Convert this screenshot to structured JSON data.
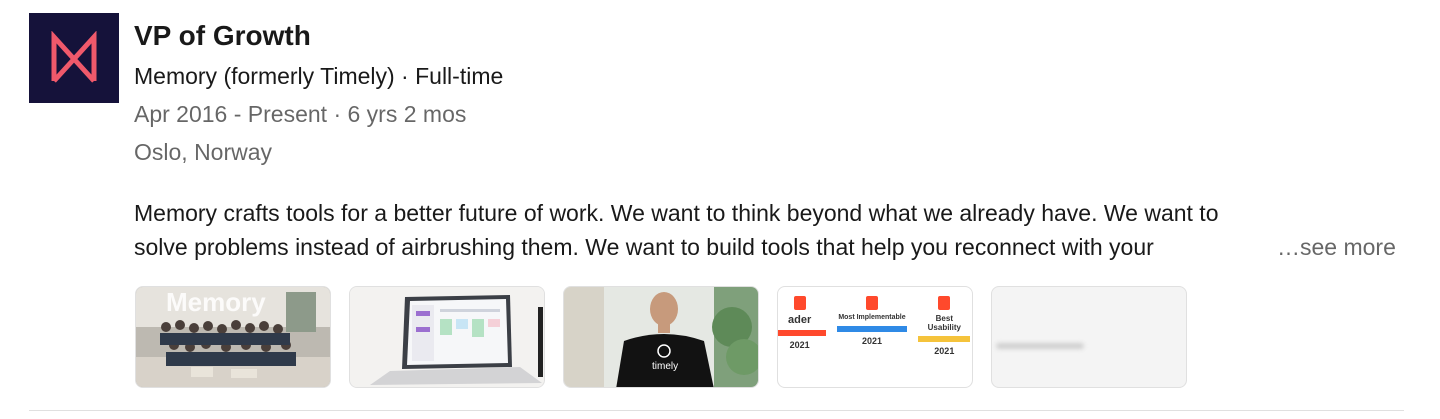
{
  "experience": {
    "title": "VP of Growth",
    "company_line": "Memory (formerly Timely) · Full-time",
    "dates": "Apr 2016 - Present · 6 yrs 2 mos",
    "location": "Oslo, Norway",
    "description_line1": "Memory crafts tools for a better future of work. We want to think beyond what we already have. We want to",
    "description_line2": "solve problems instead of airbrushing them. We want to build tools that help you reconnect with your",
    "see_more": "…see more"
  },
  "media": {
    "team_photo_caption": "Memory",
    "tshirt_text": "timely",
    "badges": [
      {
        "label": "ader",
        "year": "2021"
      },
      {
        "label": "Most Implementable",
        "year": "2021"
      },
      {
        "label": "Best Usability",
        "year": "2021"
      }
    ]
  },
  "colors": {
    "logo_bg": "#15123a",
    "logo_mark": "#f0596b"
  }
}
